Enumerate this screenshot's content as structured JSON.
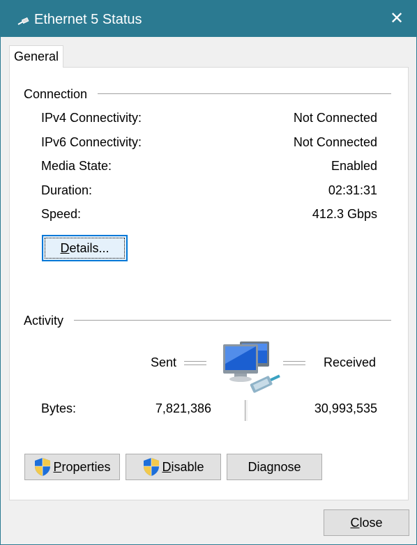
{
  "window": {
    "title": "Ethernet 5 Status",
    "icon": "ethernet-icon",
    "close_glyph": "✕"
  },
  "tabs": [
    {
      "label": "General",
      "selected": true
    }
  ],
  "connection": {
    "heading": "Connection",
    "rows": [
      {
        "label": "IPv4 Connectivity:",
        "value": "Not Connected"
      },
      {
        "label": "IPv6 Connectivity:",
        "value": "Not Connected"
      },
      {
        "label": "Media State:",
        "value": "Enabled"
      },
      {
        "label": "Duration:",
        "value": "02:31:31"
      },
      {
        "label": "Speed:",
        "value": "412.3 Gbps"
      }
    ],
    "details_button": {
      "pre": "",
      "mnemonic": "D",
      "post": "etails..."
    }
  },
  "activity": {
    "heading": "Activity",
    "sent_label": "Sent",
    "received_label": "Received",
    "bytes_label": "Bytes:",
    "bytes_sent": "7,821,386",
    "bytes_received": "30,993,535",
    "icon": "network-computers-icon"
  },
  "buttons": {
    "properties": {
      "pre": "",
      "mnemonic": "P",
      "post": "roperties",
      "icon": "uac-shield-icon"
    },
    "disable": {
      "pre": "",
      "mnemonic": "D",
      "post": "isable",
      "icon": "uac-shield-icon"
    },
    "diagnose": {
      "pre": "Diagnose",
      "mnemonic": "",
      "post": ""
    },
    "close": {
      "pre": "",
      "mnemonic": "C",
      "post": "lose"
    }
  },
  "colors": {
    "titlebar": "#2b7a91",
    "focus_border": "#0078d7",
    "button_face": "#e1e1e1"
  }
}
